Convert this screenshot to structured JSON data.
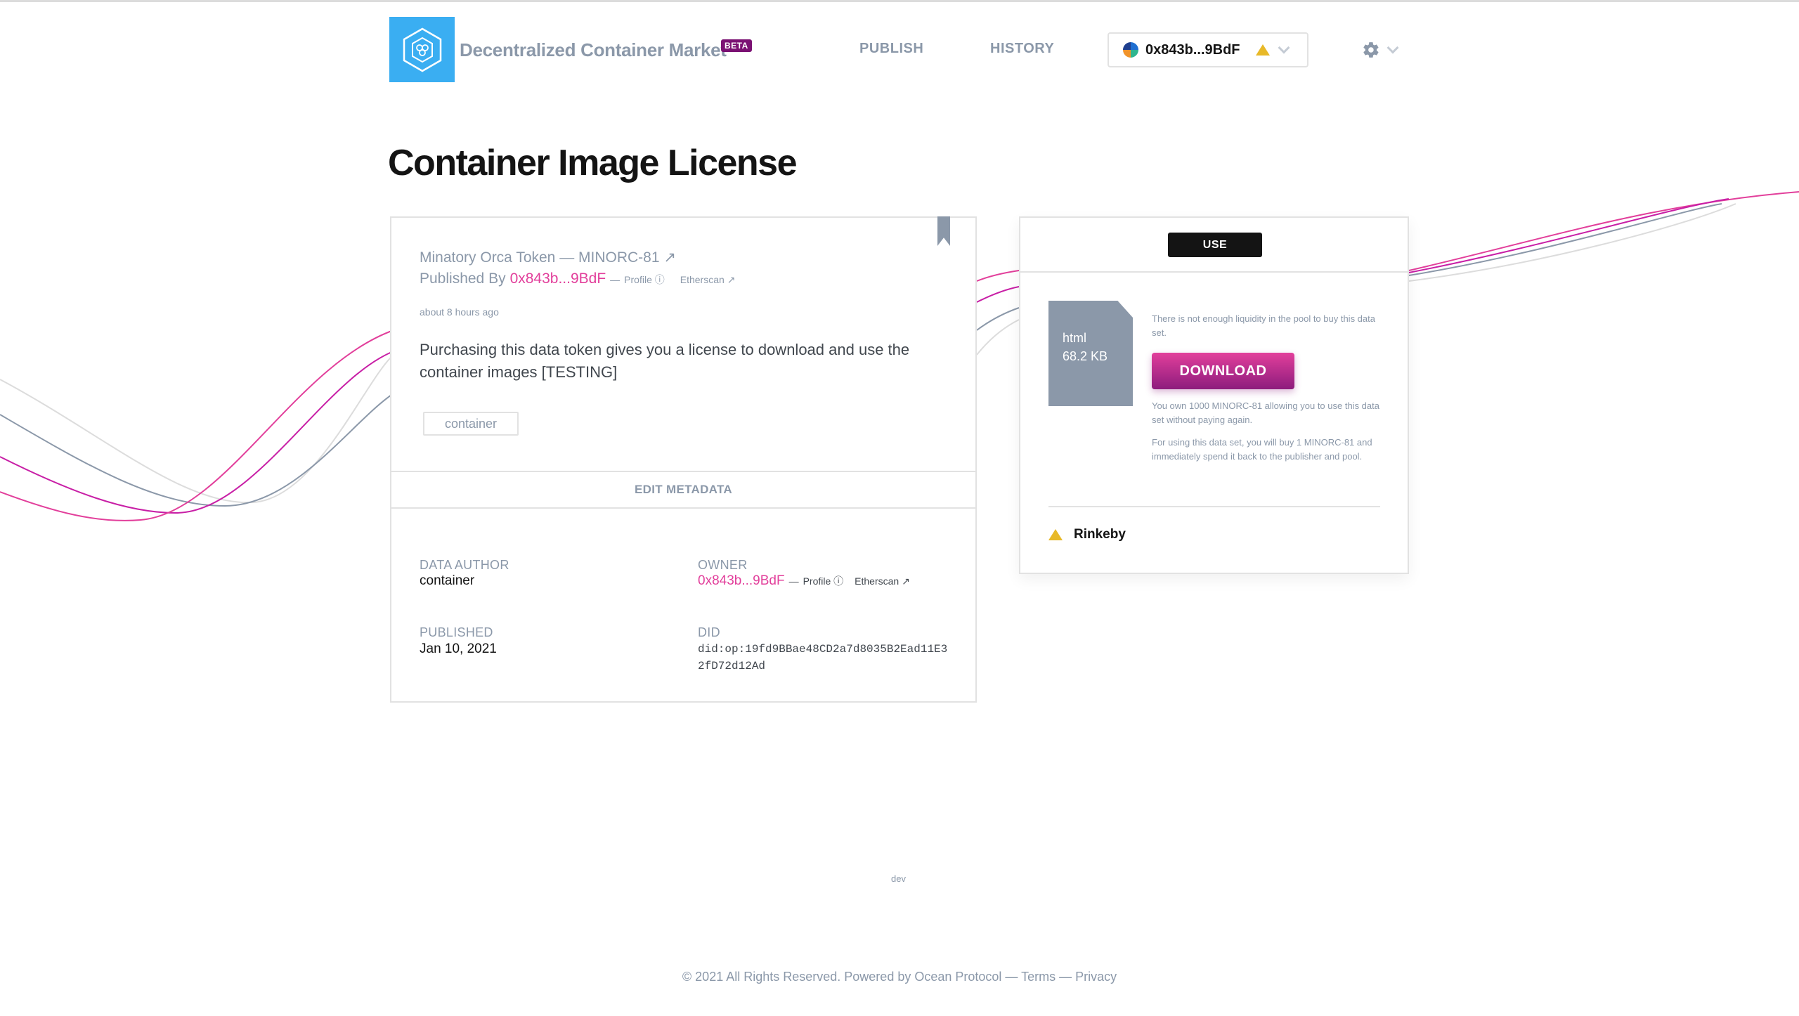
{
  "header": {
    "brand": "Decentralized Container Market",
    "beta": "BETA",
    "nav": {
      "publish": "PUBLISH",
      "history": "HISTORY"
    },
    "wallet": {
      "address": "0x843b...9BdF"
    }
  },
  "page": {
    "title": "Container Image License"
  },
  "asset": {
    "token": "Minatory Orca Token — MINORC-81 ↗",
    "published_by_label": "Published By",
    "publisher": "0x843b...9BdF",
    "dash": "—",
    "profile": "Profile ⓘ",
    "etherscan": "Etherscan ↗",
    "ago": "about 8 hours ago",
    "description": "Purchasing this data token gives you a license to download and use the container images [TESTING]",
    "tag": "container",
    "edit_metadata": "EDIT METADATA"
  },
  "metadata": {
    "data_author_label": "DATA AUTHOR",
    "data_author": "container",
    "owner_label": "OWNER",
    "owner": "0x843b...9BdF",
    "owner_dash": "—",
    "owner_profile": "Profile ⓘ",
    "owner_etherscan": "Etherscan ↗",
    "published_label": "PUBLISHED",
    "published": "Jan 10, 2021",
    "did_label": "DID",
    "did": "did:op:19fd9BBae48CD2a7d8035B2Ead11E32fD72d12Ad"
  },
  "use_panel": {
    "tab": "USE",
    "file_type": "html",
    "file_size": "68.2 KB",
    "liquidity_note": "There is not enough liquidity in the pool to buy this data set.",
    "download": "DOWNLOAD",
    "own_note": "You own 1000 MINORC-81 allowing you to use this data set without paying again.",
    "buy_note": "For using this data set, you will buy 1 MINORC-81 and immediately spend it back to the publisher and pool.",
    "network": "Rinkeby"
  },
  "footer": {
    "env": "dev",
    "text": "© 2021 All Rights Reserved. Powered by Ocean Protocol — Terms — Privacy"
  },
  "colors": {
    "accent": "#e23f9b",
    "logo": "#3aaef2",
    "muted": "#8b98a9",
    "warning": "#e8b928"
  },
  "icons": [
    "logo-hexagon-icon",
    "warning-icon",
    "chevron-down-icon",
    "gear-icon",
    "bookmark-icon",
    "file-icon"
  ]
}
